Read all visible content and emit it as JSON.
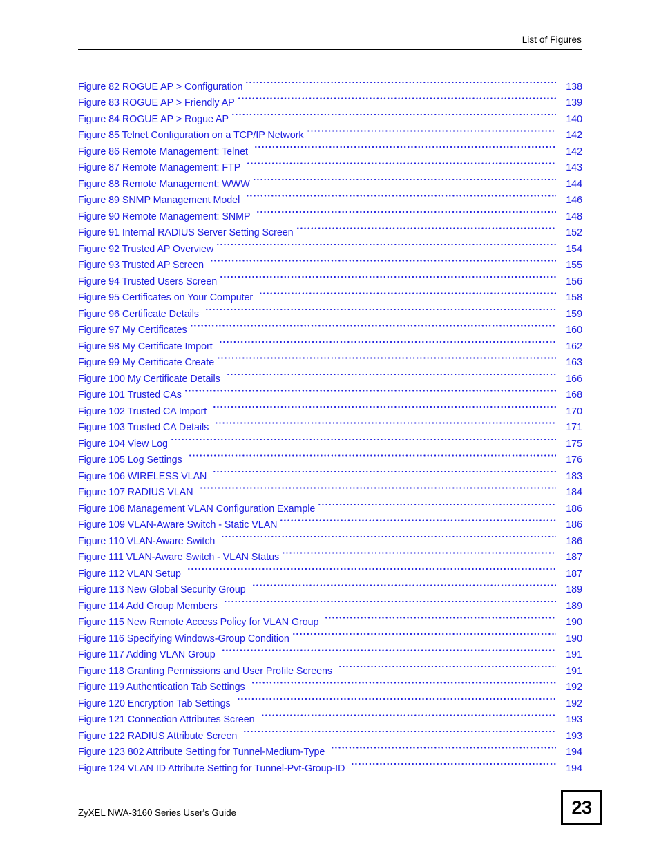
{
  "header": {
    "title": "List of Figures"
  },
  "footer": {
    "guide_title": "ZyXEL NWA-3160 Series User's Guide",
    "page_number": "23"
  },
  "list_of_figures": {
    "entries": [
      {
        "label": "Figure 82 ROGUE AP > Configuration",
        "page": "138",
        "wide_gap": false
      },
      {
        "label": "Figure 83 ROGUE AP > Friendly AP",
        "page": "139",
        "wide_gap": false
      },
      {
        "label": "Figure 84 ROGUE AP > Rogue AP",
        "page": "140",
        "wide_gap": false
      },
      {
        "label": "Figure 85 Telnet Configuration on a TCP/IP Network",
        "page": "142",
        "wide_gap": false
      },
      {
        "label": "Figure 86 Remote Management: Telnet",
        "page": "142",
        "wide_gap": true
      },
      {
        "label": "Figure 87 Remote Management: FTP",
        "page": "143",
        "wide_gap": true
      },
      {
        "label": "Figure 88 Remote Management: WWW",
        "page": "144",
        "wide_gap": false
      },
      {
        "label": "Figure 89 SNMP Management Model",
        "page": "146",
        "wide_gap": true
      },
      {
        "label": "Figure 90 Remote Management: SNMP",
        "page": "148",
        "wide_gap": true
      },
      {
        "label": "Figure 91 Internal RADIUS Server Setting Screen",
        "page": "152",
        "wide_gap": false
      },
      {
        "label": "Figure 92 Trusted AP Overview",
        "page": "154",
        "wide_gap": false
      },
      {
        "label": "Figure 93 Trusted AP Screen",
        "page": "155",
        "wide_gap": true
      },
      {
        "label": "Figure 94 Trusted Users Screen",
        "page": "156",
        "wide_gap": false
      },
      {
        "label": "Figure 95 Certificates on Your Computer",
        "page": "158",
        "wide_gap": true
      },
      {
        "label": "Figure 96 Certificate Details",
        "page": "159",
        "wide_gap": true
      },
      {
        "label": "Figure 97 My Certificates",
        "page": "160",
        "wide_gap": false
      },
      {
        "label": "Figure 98 My Certificate Import",
        "page": "162",
        "wide_gap": true
      },
      {
        "label": "Figure 99 My Certificate Create",
        "page": "163",
        "wide_gap": false
      },
      {
        "label": "Figure 100 My Certificate Details",
        "page": "166",
        "wide_gap": true
      },
      {
        "label": "Figure 101 Trusted CAs",
        "page": "168",
        "wide_gap": false
      },
      {
        "label": "Figure 102 Trusted CA Import",
        "page": "170",
        "wide_gap": true
      },
      {
        "label": "Figure 103 Trusted CA Details",
        "page": "171",
        "wide_gap": true
      },
      {
        "label": "Figure 104 View Log",
        "page": "175",
        "wide_gap": false
      },
      {
        "label": "Figure 105 Log Settings",
        "page": "176",
        "wide_gap": true
      },
      {
        "label": "Figure 106 WIRELESS VLAN",
        "page": "183",
        "wide_gap": true
      },
      {
        "label": "Figure 107 RADIUS VLAN",
        "page": "184",
        "wide_gap": true
      },
      {
        "label": "Figure 108 Management VLAN Configuration Example",
        "page": "186",
        "wide_gap": false
      },
      {
        "label": "Figure 109 VLAN-Aware Switch - Static VLAN",
        "page": "186",
        "wide_gap": false
      },
      {
        "label": "Figure 110 VLAN-Aware Switch",
        "page": "186",
        "wide_gap": true
      },
      {
        "label": "Figure 111 VLAN-Aware Switch - VLAN Status",
        "page": "187",
        "wide_gap": false
      },
      {
        "label": "Figure 112 VLAN Setup",
        "page": "187",
        "wide_gap": true
      },
      {
        "label": "Figure 113 New Global Security Group",
        "page": "189",
        "wide_gap": true
      },
      {
        "label": "Figure 114 Add Group Members",
        "page": "189",
        "wide_gap": true
      },
      {
        "label": "Figure 115 New Remote Access Policy for VLAN Group",
        "page": "190",
        "wide_gap": true
      },
      {
        "label": "Figure 116 Specifying Windows-Group Condition",
        "page": "190",
        "wide_gap": false
      },
      {
        "label": "Figure 117 Adding VLAN Group",
        "page": "191",
        "wide_gap": true
      },
      {
        "label": "Figure 118 Granting Permissions and User Profile Screens",
        "page": "191",
        "wide_gap": true
      },
      {
        "label": "Figure 119 Authentication Tab Settings",
        "page": "192",
        "wide_gap": true
      },
      {
        "label": "Figure 120 Encryption Tab Settings",
        "page": "192",
        "wide_gap": true
      },
      {
        "label": "Figure 121 Connection Attributes Screen",
        "page": "193",
        "wide_gap": true
      },
      {
        "label": "Figure 122 RADIUS Attribute Screen",
        "page": "193",
        "wide_gap": true
      },
      {
        "label": "Figure 123 802 Attribute Setting for Tunnel-Medium-Type",
        "page": "194",
        "wide_gap": true
      },
      {
        "label": "Figure 124 VLAN ID Attribute Setting for Tunnel-Pvt-Group-ID",
        "page": "194",
        "wide_gap": true
      }
    ]
  }
}
